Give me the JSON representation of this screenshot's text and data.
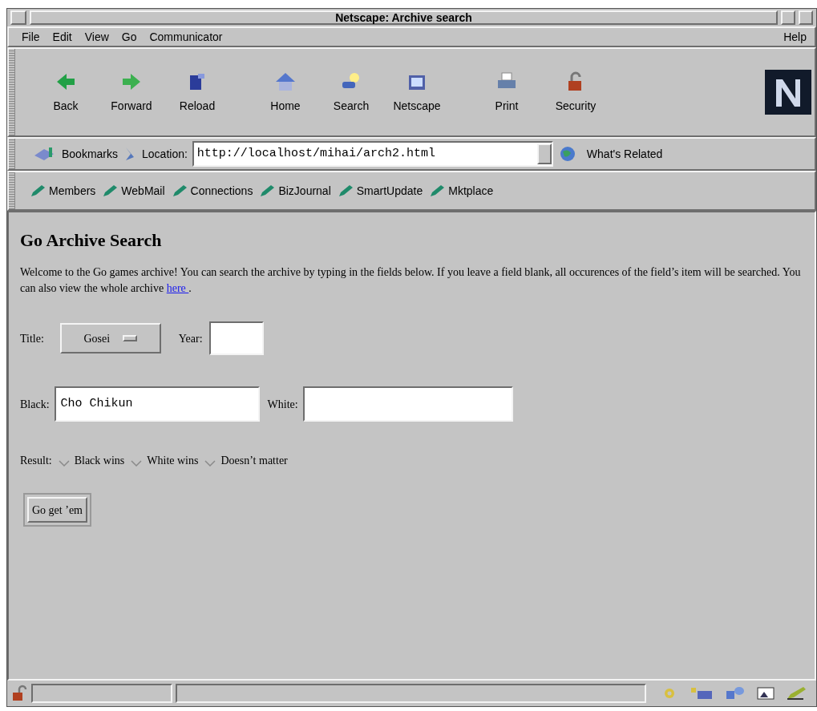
{
  "window": {
    "title": "Netscape: Archive search"
  },
  "menu": {
    "items": [
      "File",
      "Edit",
      "View",
      "Go",
      "Communicator"
    ],
    "help": "Help"
  },
  "toolbar": [
    {
      "label": "Back",
      "kind": "back"
    },
    {
      "label": "Forward",
      "kind": "forward"
    },
    {
      "label": "Reload",
      "kind": "reload"
    },
    {
      "label": "Home",
      "kind": "home"
    },
    {
      "label": "Search",
      "kind": "search"
    },
    {
      "label": "Netscape",
      "kind": "netscape"
    },
    {
      "label": "Print",
      "kind": "print"
    },
    {
      "label": "Security",
      "kind": "security"
    }
  ],
  "location_bar": {
    "bookmarks": "Bookmarks",
    "label": "Location:",
    "url": "http://localhost/mihai/arch2.html",
    "related": "What's Related"
  },
  "personal_toolbar": [
    "Members",
    "WebMail",
    "Connections",
    "BizJournal",
    "SmartUpdate",
    "Mktplace"
  ],
  "page": {
    "heading": "Go Archive Search",
    "intro": "Welcome to the Go games archive! You can search the archive by typing in the fields below. If you leave a field blank, all occurences of the field’s item will be searched. You can also view the whole archive",
    "link": "here ",
    "after_link": ".",
    "title_label": "Title:",
    "title_value": "Gosei",
    "year_label": "Year:",
    "black_label": "Black:",
    "black_value": "Cho Chikun",
    "white_label": "White:",
    "result_label": "Result:",
    "results": [
      {
        "label": "Black wins",
        "selected": false
      },
      {
        "label": "White wins",
        "selected": false
      },
      {
        "label": "Doesn’t matter",
        "selected": false
      }
    ],
    "submit": "Go get ’em"
  }
}
